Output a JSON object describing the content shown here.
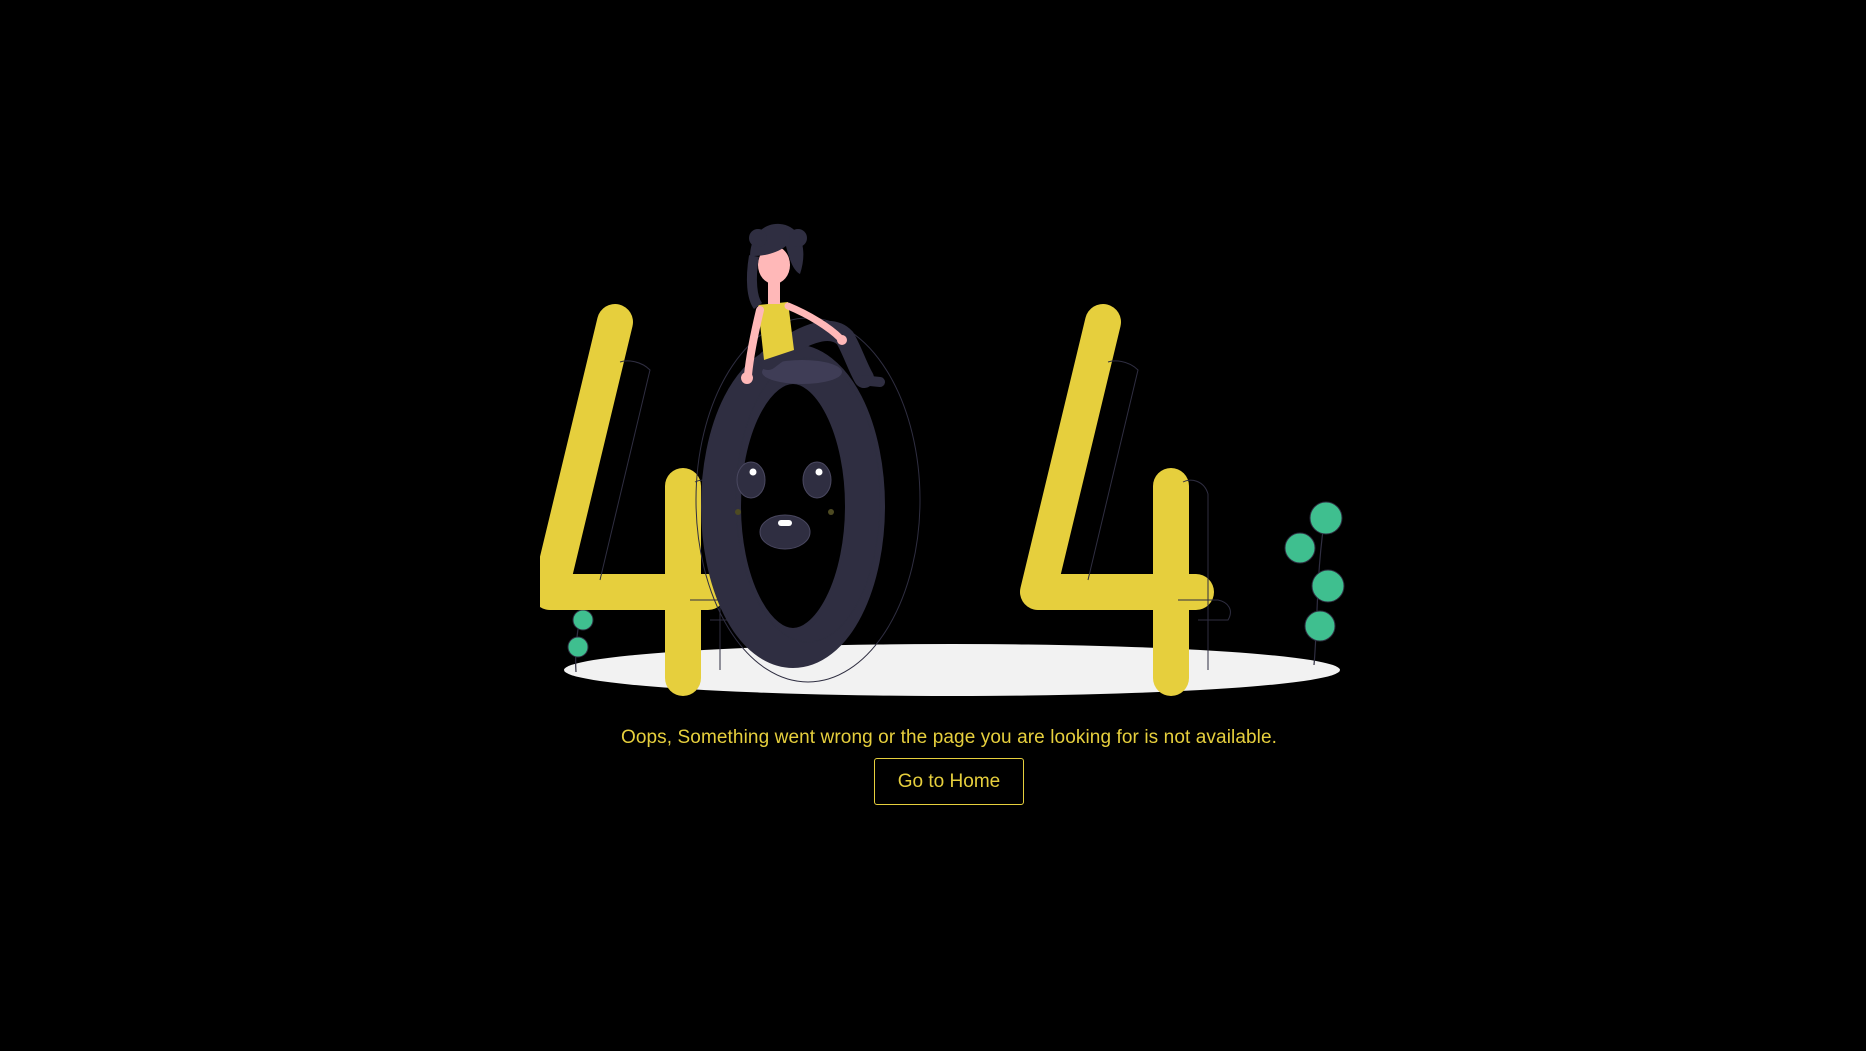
{
  "illustration": {
    "icon": "404-illustration",
    "text": "404"
  },
  "message": "Oops, Something went wrong or the page you are looking for is not available.",
  "button": {
    "label": "Go to Home"
  },
  "colors": {
    "background": "#000000",
    "accent": "#e6cf3d",
    "zero": "#2f2e41",
    "leaf": "#3fbf8f",
    "floor": "#f2f2f2",
    "skin": "#ffb8b8"
  }
}
